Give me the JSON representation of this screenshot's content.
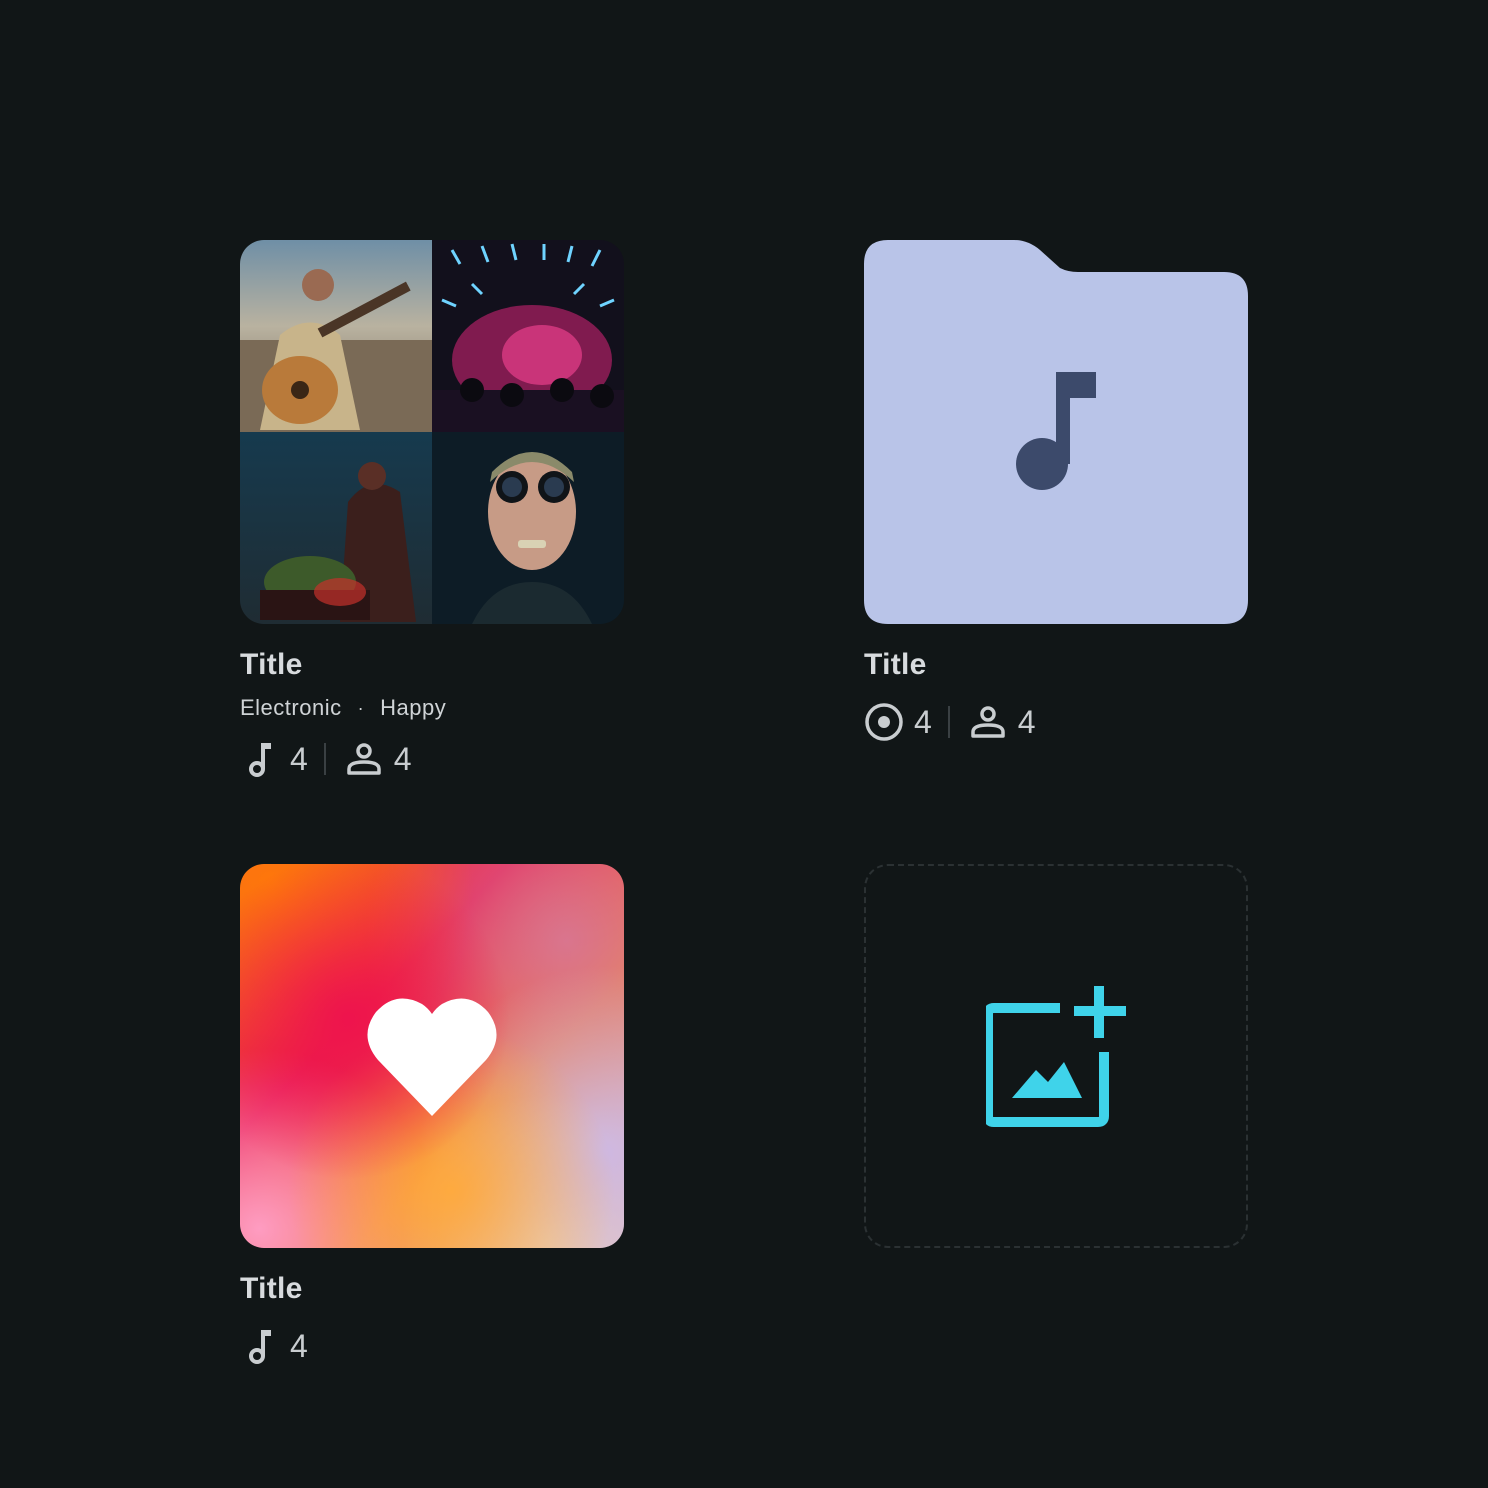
{
  "colors": {
    "background": "#111617",
    "folder_fill": "#b9c4e8",
    "folder_icon": "#3c4a6b",
    "add_image_accent": "#3fd3ea",
    "text_primary": "#d8dbde"
  },
  "cards": [
    {
      "type": "playlist-collage",
      "title": "Title",
      "tags": [
        "Electronic",
        "Happy"
      ],
      "tag_separator": "·",
      "stats": [
        {
          "icon": "music-note-icon",
          "value": "4"
        },
        {
          "icon": "person-icon",
          "value": "4"
        }
      ]
    },
    {
      "type": "folder",
      "title": "Title",
      "stats": [
        {
          "icon": "disc-icon",
          "value": "4"
        },
        {
          "icon": "person-icon",
          "value": "4"
        }
      ]
    },
    {
      "type": "liked-songs",
      "title": "Title",
      "stats": [
        {
          "icon": "music-note-icon",
          "value": "4"
        }
      ]
    },
    {
      "type": "add-cover-placeholder",
      "icon": "add-photo-icon"
    }
  ]
}
